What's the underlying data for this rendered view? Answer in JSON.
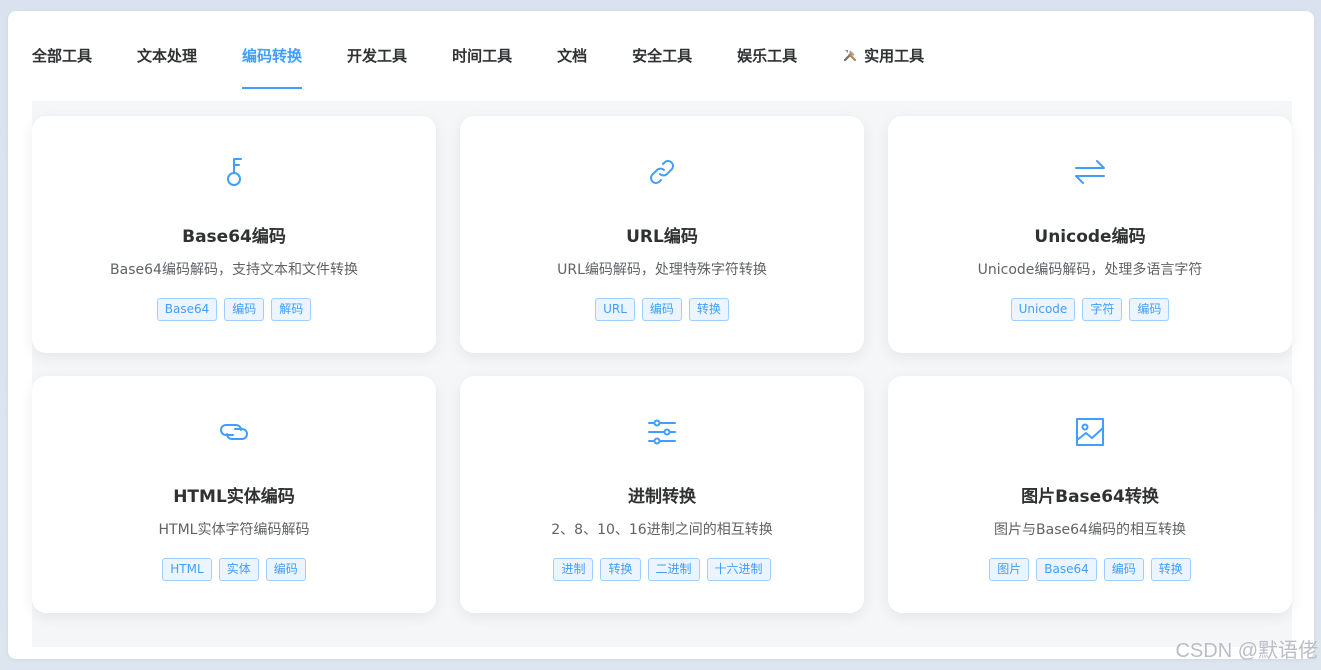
{
  "tabs": [
    {
      "label": "全部工具",
      "active": false
    },
    {
      "label": "文本处理",
      "active": false
    },
    {
      "label": "编码转换",
      "active": true
    },
    {
      "label": "开发工具",
      "active": false
    },
    {
      "label": "时间工具",
      "active": false
    },
    {
      "label": "文档",
      "active": false
    },
    {
      "label": "安全工具",
      "active": false
    },
    {
      "label": "娱乐工具",
      "active": false
    },
    {
      "label": "实用工具",
      "active": false,
      "icon": "tools-icon"
    }
  ],
  "accent_color": "#409eff",
  "cards": [
    {
      "icon": "key-icon",
      "title": "Base64编码",
      "desc": "Base64编码解码，支持文本和文件转换",
      "tags": [
        "Base64",
        "编码",
        "解码"
      ]
    },
    {
      "icon": "link-icon",
      "title": "URL编码",
      "desc": "URL编码解码，处理特殊字符转换",
      "tags": [
        "URL",
        "编码",
        "转换"
      ]
    },
    {
      "icon": "swap-arrows-icon",
      "title": "Unicode编码",
      "desc": "Unicode编码解码，处理多语言字符",
      "tags": [
        "Unicode",
        "字符",
        "编码"
      ]
    },
    {
      "icon": "connection-icon",
      "title": "HTML实体编码",
      "desc": "HTML实体字符编码解码",
      "tags": [
        "HTML",
        "实体",
        "编码"
      ]
    },
    {
      "icon": "sliders-icon",
      "title": "进制转换",
      "desc": "2、8、10、16进制之间的相互转换",
      "tags": [
        "进制",
        "转换",
        "二进制",
        "十六进制"
      ]
    },
    {
      "icon": "picture-icon",
      "title": "图片Base64转换",
      "desc": "图片与Base64编码的相互转换",
      "tags": [
        "图片",
        "Base64",
        "编码",
        "转换"
      ]
    }
  ],
  "watermark": "CSDN @默语佬"
}
